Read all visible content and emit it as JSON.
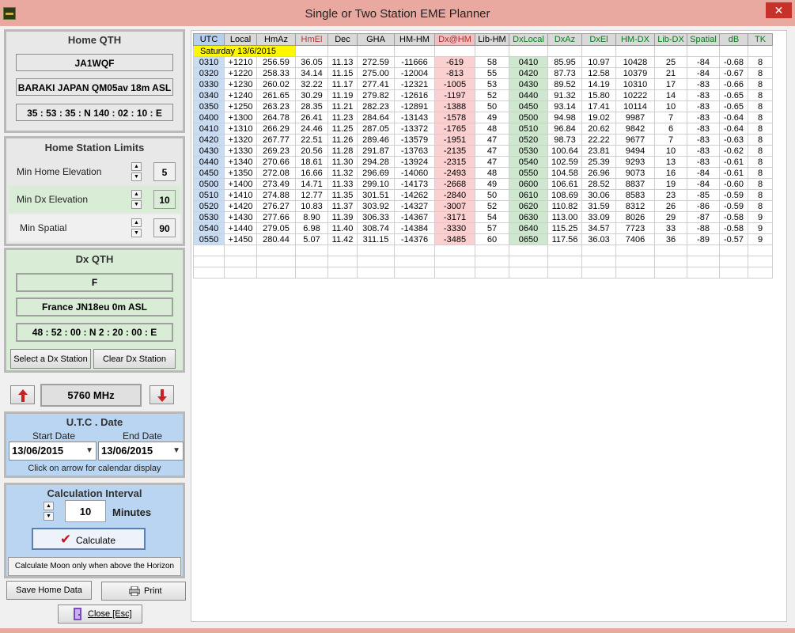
{
  "window": {
    "title": "Single or Two Station EME Planner",
    "close_glyph": "✕"
  },
  "home_qth": {
    "title": "Home  QTH",
    "callsign": "JA1WQF",
    "location": "BARAKI JAPAN  QM05av  18m ASL",
    "coords": "35 : 53 : 35 : N  140 : 02 : 10 : E"
  },
  "limits": {
    "title": "Home Station Limits",
    "rows": [
      {
        "label": "Min  Home Elevation",
        "value": "5"
      },
      {
        "label": "Min  Dx  Elevation",
        "value": "10"
      },
      {
        "label": "Min Spatial",
        "value": "90"
      }
    ]
  },
  "dx_qth": {
    "title": "Dx  QTH",
    "callsign": "F",
    "location": "France  JN18eu  0m ASL",
    "coords": "48 : 52 : 00 : N  2 : 20 : 00 : E",
    "select_button": "Select a Dx Station",
    "clear_button": "Clear Dx Station"
  },
  "frequency": {
    "value": "5760 MHz"
  },
  "date": {
    "title": "U.T.C . Date",
    "start_label": "Start Date",
    "end_label": "End Date",
    "start_value": "13/06/2015",
    "end_value": "13/06/2015",
    "hint": "Click on arrow for calendar display"
  },
  "calc": {
    "title": "Calculation Interval",
    "interval": "10",
    "unit": "Minutes",
    "button": "Calculate",
    "horizon_button": "Calculate Moon only when above the Horizon"
  },
  "footer": {
    "save": "Save Home Data",
    "print": "Print",
    "close": "Close [Esc]"
  },
  "table": {
    "headers": [
      "UTC",
      "Local",
      "HmAz",
      "HmEl",
      "Dec",
      "GHA",
      "HM-HM",
      "Dx@HM",
      "Lib-HM",
      "DxLocal",
      "DxAz",
      "DxEl",
      "HM-DX",
      "Lib-DX",
      "Spatial",
      "dB",
      "TK"
    ],
    "day_label": "Saturday 13/6/2015",
    "rows": [
      [
        "0310",
        "+1210",
        "256.59",
        "36.05",
        "11.13",
        "272.59",
        "-11666",
        "-619",
        "58",
        "0410",
        "85.95",
        "10.97",
        "10428",
        "25",
        "-84",
        "-0.68",
        "8"
      ],
      [
        "0320",
        "+1220",
        "258.33",
        "34.14",
        "11.15",
        "275.00",
        "-12004",
        "-813",
        "55",
        "0420",
        "87.73",
        "12.58",
        "10379",
        "21",
        "-84",
        "-0.67",
        "8"
      ],
      [
        "0330",
        "+1230",
        "260.02",
        "32.22",
        "11.17",
        "277.41",
        "-12321",
        "-1005",
        "53",
        "0430",
        "89.52",
        "14.19",
        "10310",
        "17",
        "-83",
        "-0.66",
        "8"
      ],
      [
        "0340",
        "+1240",
        "261.65",
        "30.29",
        "11.19",
        "279.82",
        "-12616",
        "-1197",
        "52",
        "0440",
        "91.32",
        "15.80",
        "10222",
        "14",
        "-83",
        "-0.65",
        "8"
      ],
      [
        "0350",
        "+1250",
        "263.23",
        "28.35",
        "11.21",
        "282.23",
        "-12891",
        "-1388",
        "50",
        "0450",
        "93.14",
        "17.41",
        "10114",
        "10",
        "-83",
        "-0.65",
        "8"
      ],
      [
        "0400",
        "+1300",
        "264.78",
        "26.41",
        "11.23",
        "284.64",
        "-13143",
        "-1578",
        "49",
        "0500",
        "94.98",
        "19.02",
        "9987",
        "7",
        "-83",
        "-0.64",
        "8"
      ],
      [
        "0410",
        "+1310",
        "266.29",
        "24.46",
        "11.25",
        "287.05",
        "-13372",
        "-1765",
        "48",
        "0510",
        "96.84",
        "20.62",
        "9842",
        "6",
        "-83",
        "-0.64",
        "8"
      ],
      [
        "0420",
        "+1320",
        "267.77",
        "22.51",
        "11.26",
        "289.46",
        "-13579",
        "-1951",
        "47",
        "0520",
        "98.73",
        "22.22",
        "9677",
        "7",
        "-83",
        "-0.63",
        "8"
      ],
      [
        "0430",
        "+1330",
        "269.23",
        "20.56",
        "11.28",
        "291.87",
        "-13763",
        "-2135",
        "47",
        "0530",
        "100.64",
        "23.81",
        "9494",
        "10",
        "-83",
        "-0.62",
        "8"
      ],
      [
        "0440",
        "+1340",
        "270.66",
        "18.61",
        "11.30",
        "294.28",
        "-13924",
        "-2315",
        "47",
        "0540",
        "102.59",
        "25.39",
        "9293",
        "13",
        "-83",
        "-0.61",
        "8"
      ],
      [
        "0450",
        "+1350",
        "272.08",
        "16.66",
        "11.32",
        "296.69",
        "-14060",
        "-2493",
        "48",
        "0550",
        "104.58",
        "26.96",
        "9073",
        "16",
        "-84",
        "-0.61",
        "8"
      ],
      [
        "0500",
        "+1400",
        "273.49",
        "14.71",
        "11.33",
        "299.10",
        "-14173",
        "-2668",
        "49",
        "0600",
        "106.61",
        "28.52",
        "8837",
        "19",
        "-84",
        "-0.60",
        "8"
      ],
      [
        "0510",
        "+1410",
        "274.88",
        "12.77",
        "11.35",
        "301.51",
        "-14262",
        "-2840",
        "50",
        "0610",
        "108.69",
        "30.06",
        "8583",
        "23",
        "-85",
        "-0.59",
        "8"
      ],
      [
        "0520",
        "+1420",
        "276.27",
        "10.83",
        "11.37",
        "303.92",
        "-14327",
        "-3007",
        "52",
        "0620",
        "110.82",
        "31.59",
        "8312",
        "26",
        "-86",
        "-0.59",
        "8"
      ],
      [
        "0530",
        "+1430",
        "277.66",
        "8.90",
        "11.39",
        "306.33",
        "-14367",
        "-3171",
        "54",
        "0630",
        "113.00",
        "33.09",
        "8026",
        "29",
        "-87",
        "-0.58",
        "9"
      ],
      [
        "0540",
        "+1440",
        "279.05",
        "6.98",
        "11.40",
        "308.74",
        "-14384",
        "-3330",
        "57",
        "0640",
        "115.25",
        "34.57",
        "7723",
        "33",
        "-88",
        "-0.58",
        "9"
      ],
      [
        "0550",
        "+1450",
        "280.44",
        "5.07",
        "11.42",
        "311.15",
        "-14376",
        "-3485",
        "60",
        "0650",
        "117.56",
        "36.03",
        "7406",
        "36",
        "-89",
        "-0.57",
        "9"
      ]
    ],
    "empty_rows": 3
  },
  "colors": {
    "titlebar": "#e9a8a0",
    "utc_col": "#c9dcf2",
    "dx_hm_col": "#fad0d0",
    "dx_local_col": "#cfe7cf",
    "day_highlight": "#fff700"
  }
}
